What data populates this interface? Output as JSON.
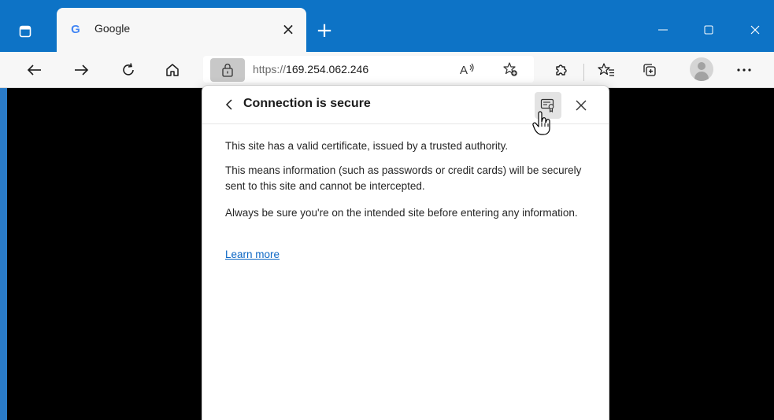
{
  "tab": {
    "favicon": "G",
    "title": "Google",
    "close": "×"
  },
  "newtab": "+",
  "address": {
    "scheme": "https://",
    "host": "169.254.062.246"
  },
  "popup": {
    "title": "Connection is secure",
    "p1": "This site has a valid certificate, issued by a trusted authority.",
    "p2": "This means information (such as passwords or credit cards) will be securely sent to this site and cannot be intercepted.",
    "p3": "Always be sure you're on the intended site before entering any information.",
    "learn_more": "Learn more"
  },
  "colors": {
    "titlebar": "#0d73c6",
    "toolbar": "#f7f7f7",
    "link": "#0b66c4"
  },
  "icons": [
    "tab-actions-icon",
    "google-favicon",
    "close-icon",
    "plus-icon",
    "minimize-icon",
    "maximize-icon",
    "close-window-icon",
    "back-arrow-icon",
    "forward-arrow-icon",
    "refresh-icon",
    "home-icon",
    "lock-icon",
    "read-aloud-icon",
    "add-favorite-icon",
    "extensions-icon",
    "favorites-icon",
    "collections-icon",
    "profile-avatar",
    "more-icon",
    "chevron-left-icon",
    "certificate-icon",
    "hand-cursor-icon"
  ]
}
